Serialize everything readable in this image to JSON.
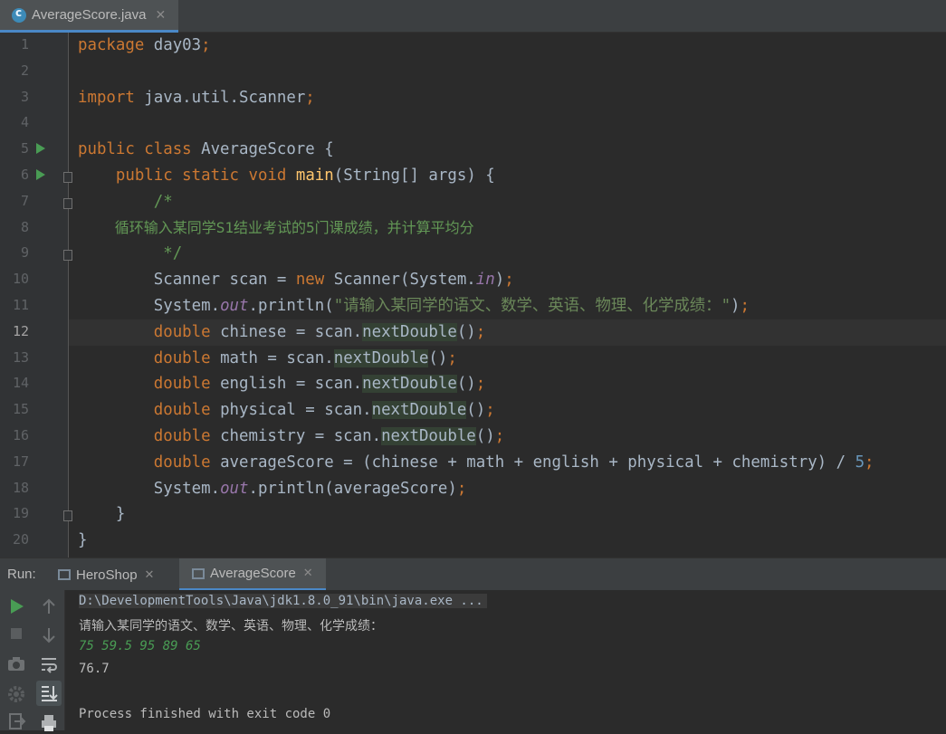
{
  "editor_tab": {
    "label": "AverageScore.java"
  },
  "code": {
    "line_numbers": [
      "1",
      "2",
      "3",
      "4",
      "5",
      "6",
      "7",
      "8",
      "9",
      "10",
      "11",
      "12",
      "13",
      "14",
      "15",
      "16",
      "17",
      "18",
      "19",
      "20"
    ],
    "l1_kw": "package",
    "l1_rest": " day03",
    "l1_semi": ";",
    "l3_kw": "import",
    "l3_rest": " java.util.Scanner",
    "l3_semi": ";",
    "l5_kw": "public class",
    "l5_rest": " AverageScore {",
    "l6_kw": "public static void",
    "l6_fn": "main",
    "l6_rest": "(String[] args) {",
    "l7": "/*",
    "l8": "循环输入某同学S1结业考试的5门课成绩，并计算平均分",
    "l9": " */",
    "l10_a": "Scanner scan = ",
    "l10_kw": "new",
    "l10_b": " Scanner(System.",
    "l10_fld": "in",
    "l10_c": ")",
    "l10_semi": ";",
    "l11_a": "System.",
    "l11_fld": "out",
    "l11_b": ".println(",
    "l11_str": "\"请输入某同学的语文、数学、英语、物理、化学成绩：\"",
    "l11_c": ")",
    "l11_semi": ";",
    "l12_kw": "double",
    "l12_a": " chinese = scan.",
    "l12_hl": "nextDouble",
    "l12_b": "()",
    "l12_semi": ";",
    "l13_kw": "double",
    "l13_a": " math = scan.",
    "l13_hl": "nextDouble",
    "l13_b": "()",
    "l13_semi": ";",
    "l14_kw": "double",
    "l14_a": " english = scan.",
    "l14_hl": "nextDouble",
    "l14_b": "()",
    "l14_semi": ";",
    "l15_kw": "double",
    "l15_a": " physical = scan.",
    "l15_hl": "nextDouble",
    "l15_b": "()",
    "l15_semi": ";",
    "l16_kw": "double",
    "l16_a": " chemistry = scan.",
    "l16_hl": "nextDouble",
    "l16_b": "()",
    "l16_semi": ";",
    "l17_kw": "double",
    "l17_a": " averageScore = (chinese + math + english + physical + chemistry) / ",
    "l17_num": "5",
    "l17_semi": ";",
    "l18_a": "System.",
    "l18_fld": "out",
    "l18_b": ".println(averageScore)",
    "l18_semi": ";",
    "l19": "}",
    "l20": "}"
  },
  "run_panel": {
    "label": "Run:",
    "tabs": [
      {
        "label": "HeroShop"
      },
      {
        "label": "AverageScore"
      }
    ]
  },
  "console": {
    "cmd": "D:\\DevelopmentTools\\Java\\jdk1.8.0_91\\bin\\java.exe ...",
    "prompt": "请输入某同学的语文、数学、英语、物理、化学成绩：",
    "input": "75 59.5 95 89 65",
    "result": "76.7",
    "exit": "Process finished with exit code 0"
  }
}
